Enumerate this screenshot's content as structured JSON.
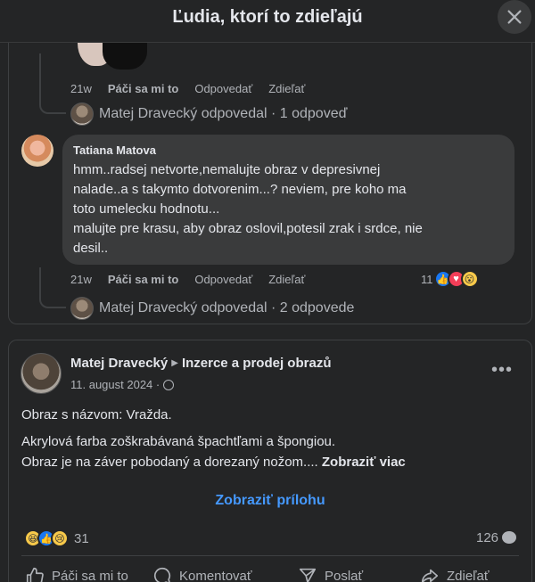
{
  "header": {
    "title": "Ľudia, ktorí to zdieľajú"
  },
  "comment_reply": {
    "time": "21w",
    "like_label": "Páči sa mi to",
    "reply_label": "Odpovedať",
    "share_label": "Zdieľať",
    "thread_text": "Matej Dravecký odpovedal · 1 odpoveď"
  },
  "comment": {
    "author": "Tatiana Matova",
    "text": "hmm..radsej netvorte,nemalujte obraz v depresivnej\nnalade..a s takymto dotvorenim...? neviem, pre koho ma\ntoto umelecku hodnotu...\nmalujte pre krasu, aby obraz oslovil,potesil zrak i srdce, nie\ndesil..",
    "time": "21w",
    "like_label": "Páči sa mi to",
    "reply_label": "Odpovedať",
    "share_label": "Zdieľať",
    "reaction_count": "11",
    "reactions": [
      "like-icon",
      "love-icon",
      "wow-icon"
    ],
    "thread_text": "Matej Dravecký odpovedal · 2 odpovede"
  },
  "post": {
    "author": "Matej Dravecký",
    "group": "Inzerce a prodej obrazů",
    "date": "11. august 2024 ·",
    "line1": "Obraz s názvom: Vražda.",
    "line2": "Akrylová farba zoškrabávaná špachtľami a špongiou.",
    "line3": "Obraz je na záver pobodaný a dorezaný nožom.... ",
    "see_more": "Zobraziť viac",
    "attachment_label": "Zobraziť prílohu",
    "reaction_count": "31",
    "reactions": [
      "haha-icon",
      "like-icon",
      "sad-icon"
    ],
    "comment_count": "126",
    "actions": {
      "like": "Páči sa mi to",
      "comment": "Komentovať",
      "send": "Poslať",
      "share": "Zdieľať"
    }
  },
  "colors": {
    "background": "#242526",
    "bubble": "#3a3b3c",
    "link": "#4599ff",
    "secondary_text": "#b0b3b8"
  }
}
